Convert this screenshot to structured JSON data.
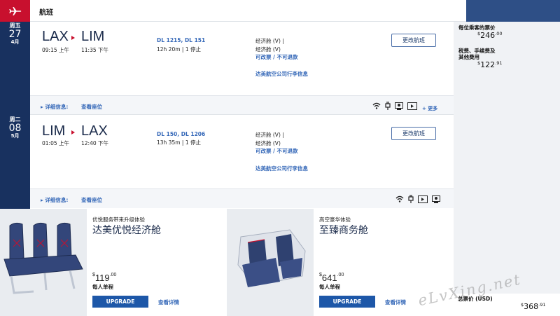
{
  "header": {
    "title": "航班"
  },
  "segments": [
    {
      "date": {
        "dow": "周五",
        "day": "27",
        "month": "4月"
      },
      "from": "LAX",
      "to": "LIM",
      "depart": "09:15 上午",
      "arrive": "11:35 下午",
      "flights": "DL 1215, DL 151",
      "duration": "12h 20m | 1 停止",
      "cabin1": "经济舱 (V) |",
      "cabin2": "经济舱 (V)",
      "fare_rule": "可改票 / 不可退款",
      "baggage": "达美航空公司行李信息",
      "change_btn": "更改航班",
      "details": "▸ 详细信息:",
      "seats": "查看座位",
      "more": "+ 更多",
      "amenities": [
        "wifi-icon",
        "power-icon",
        "personal-screen-icon",
        "entertainment-icon"
      ]
    },
    {
      "date": {
        "dow": "周二",
        "day": "08",
        "month": "5月"
      },
      "from": "LIM",
      "to": "LAX",
      "depart": "01:05 上午",
      "arrive": "12:40 下午",
      "flights": "DL 150, DL 1206",
      "duration": "13h 35m | 1 停止",
      "cabin1": "经济舱 (V) |",
      "cabin2": "经济舱 (V)",
      "fare_rule": "可改票 / 不可退款",
      "baggage": "达美航空公司行李信息",
      "change_btn": "更改航班",
      "details": "▸ 详细信息:",
      "seats": "查看座位",
      "amenities": [
        "wifi-icon",
        "power-icon",
        "entertainment-icon",
        "personal-screen-icon"
      ]
    }
  ],
  "pricing": {
    "per_passenger_label": "每位乘客的票价",
    "per_passenger_symbol": "$",
    "per_passenger_whole": "246",
    "per_passenger_cents": ".00",
    "taxes_label_1": "税费、手续费及",
    "taxes_label_2": "其他费用",
    "taxes_symbol": "$",
    "taxes_whole": "122",
    "taxes_cents": ".91",
    "total_label": "总票价 (USD)",
    "total_symbol": "$",
    "total_whole": "368",
    "total_cents": ".91"
  },
  "upsells": [
    {
      "tagline": "优悦服务带来升级体验",
      "title": "达美优悦经济舱",
      "symbol": "$",
      "whole": "119",
      "cents": ".00",
      "per": "每人单程",
      "button": "UPGRADE",
      "link": "查看详情"
    },
    {
      "tagline": "高空豪华体验",
      "title": "至臻商务舱",
      "symbol": "$",
      "whole": "641",
      "cents": ".00",
      "per": "每人单程",
      "button": "UPGRADE",
      "link": "查看详情"
    }
  ],
  "watermark": "eLvXing.net",
  "colors": {
    "navy": "#18315f",
    "red": "#c8102e",
    "link_blue": "#3568b8",
    "button_blue": "#1d57a8"
  }
}
